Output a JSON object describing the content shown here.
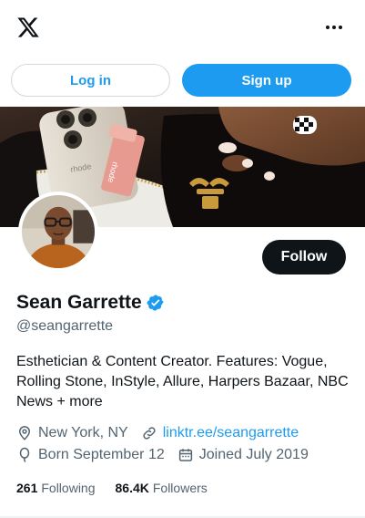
{
  "header": {
    "logo_icon": "x-logo-icon",
    "more_icon": "more-icon"
  },
  "auth": {
    "login_label": "Log in",
    "signup_label": "Sign up"
  },
  "profile": {
    "display_name": "Sean Garrette",
    "handle": "@seangarrette",
    "verified": true,
    "bio": "Esthetician & Content Creator. Features: Vogue, Rolling Stone, InStyle, Allure, Harpers Bazaar, NBC News + more",
    "follow_label": "Follow",
    "location": "New York, NY",
    "website": "linktr.ee/seangarrette",
    "birthday": "Born September 12",
    "joined": "Joined July 2019",
    "following_count": "261",
    "following_label": "Following",
    "followers_count": "86.4K",
    "followers_label": "Followers"
  },
  "banner": {
    "product_text_1": "rhode",
    "product_text_2": "rhode"
  },
  "colors": {
    "accent": "#1d9bf0",
    "text_primary": "#0f1419",
    "text_secondary": "#536471",
    "follow_bg": "#0f1419"
  }
}
